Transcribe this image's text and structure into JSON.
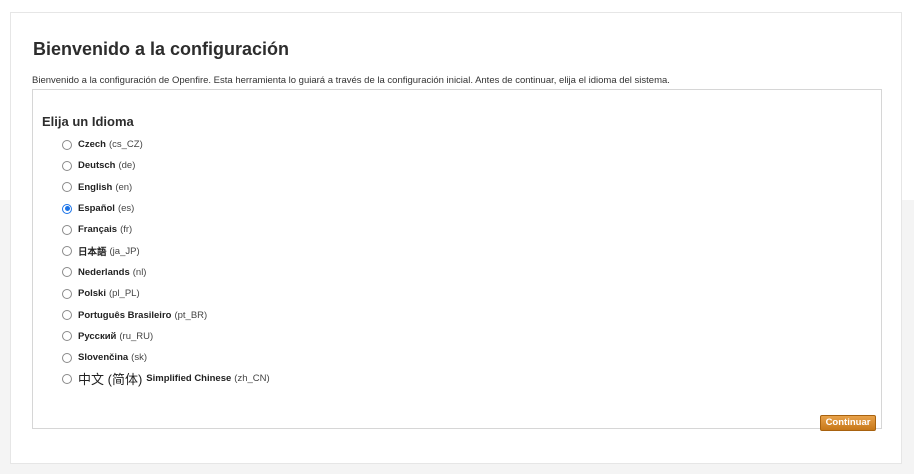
{
  "setup": {
    "title": "Bienvenido a la configuración",
    "intro": "Bienvenido a la configuración de Openfire. Esta herramienta lo guiará a través de la configuración inicial. Antes de continuar, elija el idioma del sistema.",
    "language_heading": "Elija un Idioma",
    "continue_label": "Continuar",
    "languages": [
      {
        "name": "Czech",
        "code": "(cs_CZ)",
        "selected": false
      },
      {
        "name": "Deutsch",
        "code": "(de)",
        "selected": false
      },
      {
        "name": "English",
        "code": "(en)",
        "selected": false
      },
      {
        "name": "Español",
        "code": "(es)",
        "selected": true
      },
      {
        "name": "Français",
        "code": "(fr)",
        "selected": false
      },
      {
        "name": "日本語",
        "code": "(ja_JP)",
        "selected": false
      },
      {
        "name": "Nederlands",
        "code": "(nl)",
        "selected": false
      },
      {
        "name": "Polski",
        "code": "(pl_PL)",
        "selected": false
      },
      {
        "name": "Português Brasileiro",
        "code": "(pt_BR)",
        "selected": false
      },
      {
        "name": "Русский",
        "code": "(ru_RU)",
        "selected": false
      },
      {
        "name": "Slovenčina",
        "code": "(sk)",
        "selected": false
      },
      {
        "prefix": "中文 (简体)",
        "name": "Simplified Chinese",
        "code": "(zh_CN)",
        "selected": false
      }
    ]
  }
}
